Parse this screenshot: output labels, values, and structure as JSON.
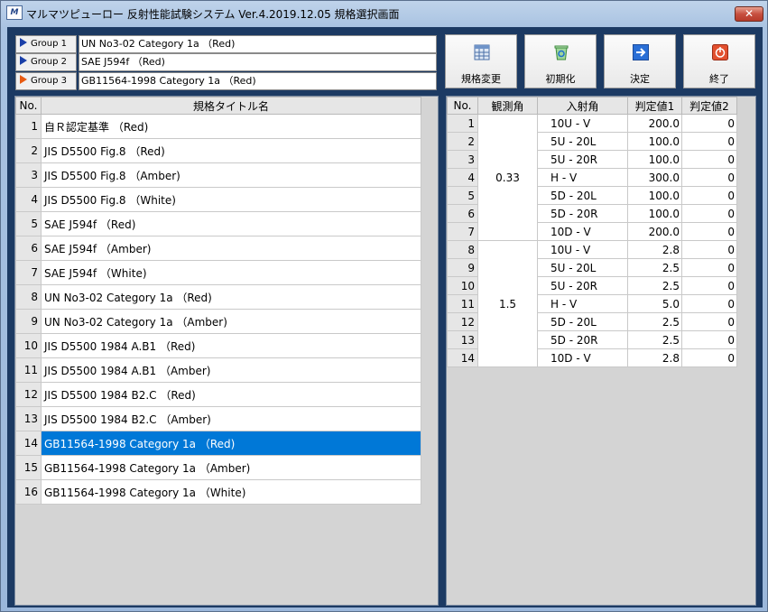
{
  "window": {
    "title": "マルマツピューロー 反射性能試験システム Ver.4.2019.12.05 規格選択画面",
    "icon": "app-logo-icon",
    "close_label": "✕"
  },
  "groups": [
    {
      "label": "Group 1",
      "value": "UN No3-02 Category 1a （Red)",
      "active": false
    },
    {
      "label": "Group 2",
      "value": "SAE J594f （Red)",
      "active": false
    },
    {
      "label": "Group 3",
      "value": "GB11564-1998 Category 1a （Red)",
      "active": true
    }
  ],
  "toolbar": {
    "change_label": "規格変更",
    "init_label": "初期化",
    "decide_label": "決定",
    "exit_label": "終了"
  },
  "left_table": {
    "col_no": "No.",
    "col_title": "規格タイトル名",
    "selected_index": 13,
    "rows": [
      {
        "no": "1",
        "title": "自Ｒ認定基準 （Red)"
      },
      {
        "no": "2",
        "title": "JIS D5500 Fig.8 （Red)"
      },
      {
        "no": "3",
        "title": "JIS D5500 Fig.8 （Amber)"
      },
      {
        "no": "4",
        "title": "JIS D5500 Fig.8 （White)"
      },
      {
        "no": "5",
        "title": "SAE J594f （Red)"
      },
      {
        "no": "6",
        "title": "SAE J594f （Amber)"
      },
      {
        "no": "7",
        "title": "SAE J594f （White)"
      },
      {
        "no": "8",
        "title": "UN No3-02 Category 1a （Red)"
      },
      {
        "no": "9",
        "title": "UN No3-02 Category 1a （Amber)"
      },
      {
        "no": "10",
        "title": "JIS D5500 1984 A.B1 （Red)"
      },
      {
        "no": "11",
        "title": "JIS D5500 1984 A.B1 （Amber)"
      },
      {
        "no": "12",
        "title": "JIS D5500 1984 B2.C （Red)"
      },
      {
        "no": "13",
        "title": "JIS D5500 1984 B2.C （Amber)"
      },
      {
        "no": "14",
        "title": "GB11564-1998 Category 1a （Red)"
      },
      {
        "no": "15",
        "title": "GB11564-1998 Category 1a （Amber)"
      },
      {
        "no": "16",
        "title": "GB11564-1998 Category 1a （White)"
      }
    ]
  },
  "right_table": {
    "col_no": "No.",
    "col_obs": "観測角",
    "col_inc": "入射角",
    "col_v1": "判定値1",
    "col_v2": "判定値2",
    "groups": [
      {
        "angle": "0.33",
        "rows": [
          {
            "no": "1",
            "inc": "10U - V",
            "v1": "200.0",
            "v2": "0"
          },
          {
            "no": "2",
            "inc": "5U - 20L",
            "v1": "100.0",
            "v2": "0"
          },
          {
            "no": "3",
            "inc": "5U - 20R",
            "v1": "100.0",
            "v2": "0"
          },
          {
            "no": "4",
            "inc": "H - V",
            "v1": "300.0",
            "v2": "0"
          },
          {
            "no": "5",
            "inc": "5D - 20L",
            "v1": "100.0",
            "v2": "0"
          },
          {
            "no": "6",
            "inc": "5D - 20R",
            "v1": "100.0",
            "v2": "0"
          },
          {
            "no": "7",
            "inc": "10D - V",
            "v1": "200.0",
            "v2": "0"
          }
        ]
      },
      {
        "angle": "1.5",
        "rows": [
          {
            "no": "8",
            "inc": "10U - V",
            "v1": "2.8",
            "v2": "0"
          },
          {
            "no": "9",
            "inc": "5U - 20L",
            "v1": "2.5",
            "v2": "0"
          },
          {
            "no": "10",
            "inc": "5U - 20R",
            "v1": "2.5",
            "v2": "0"
          },
          {
            "no": "11",
            "inc": "H - V",
            "v1": "5.0",
            "v2": "0"
          },
          {
            "no": "12",
            "inc": "5D - 20L",
            "v1": "2.5",
            "v2": "0"
          },
          {
            "no": "13",
            "inc": "5D - 20R",
            "v1": "2.5",
            "v2": "0"
          },
          {
            "no": "14",
            "inc": "10D - V",
            "v1": "2.8",
            "v2": "0"
          }
        ]
      }
    ]
  },
  "colors": {
    "client_bg": "#1c3a63",
    "selection": "#0078d7",
    "group_arrow": "#1a3fa8",
    "group_arrow_active": "#e85a10"
  }
}
